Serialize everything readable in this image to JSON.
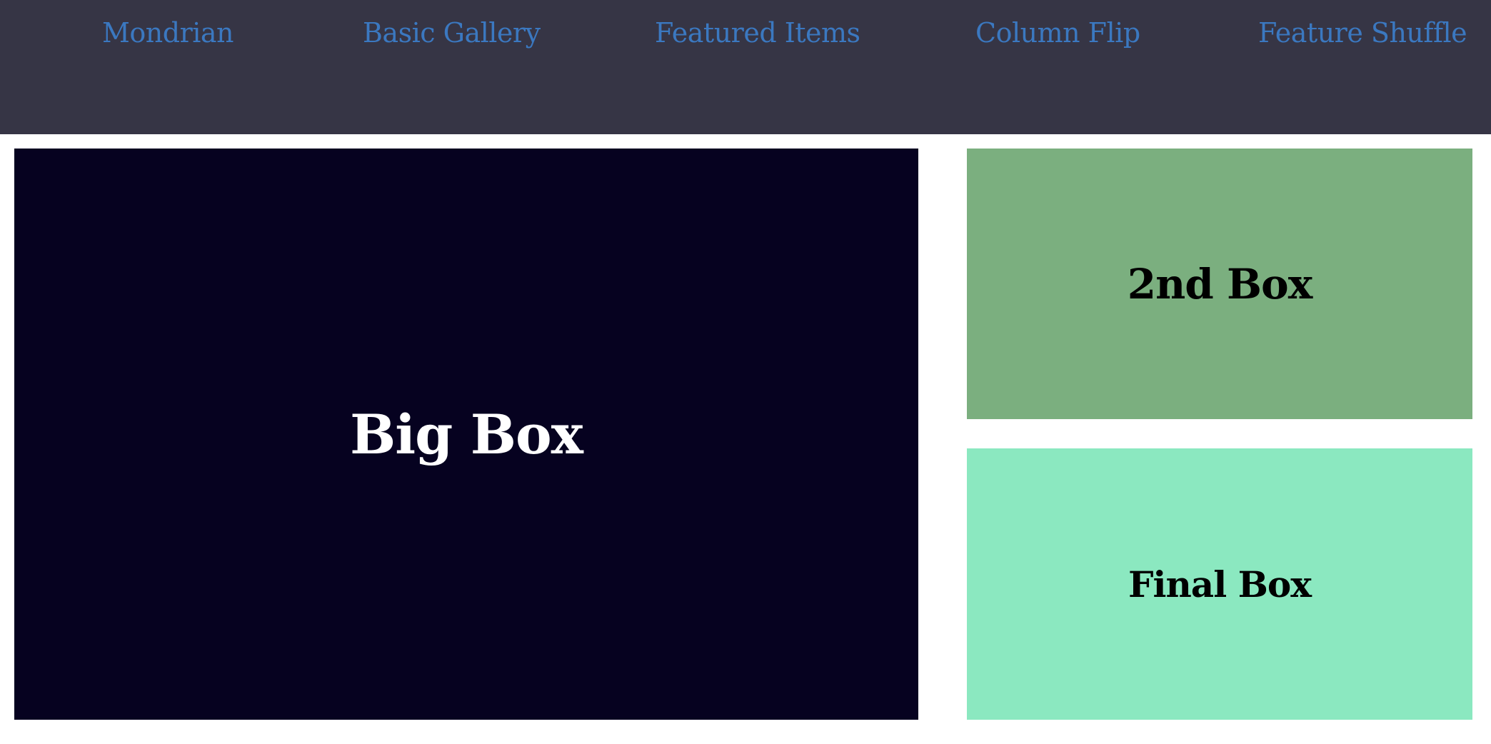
{
  "nav": {
    "links": [
      "Mondrian",
      "Basic Gallery",
      "Featured Items",
      "Column Flip",
      "Feature Shuffle"
    ]
  },
  "boxes": {
    "big": "Big Box",
    "second": "2nd Box",
    "final": "Final Box"
  },
  "colors": {
    "nav_background": "#363545",
    "nav_link": "#3b78c0",
    "big_box": "#060220",
    "second_box": "#7baf7f",
    "final_box": "#8be8c0",
    "page_background": "#ffffff"
  }
}
